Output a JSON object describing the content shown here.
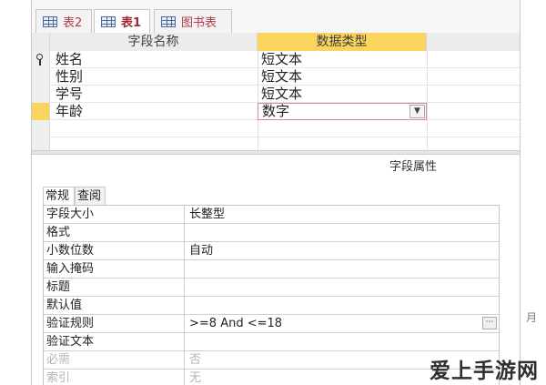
{
  "tabs": [
    {
      "label": "表2"
    },
    {
      "label": "表1"
    },
    {
      "label": "图书表"
    }
  ],
  "grid": {
    "headers": {
      "field_name": "字段名称",
      "data_type": "数据类型"
    },
    "rows": [
      {
        "name": "姓名",
        "type": "短文本"
      },
      {
        "name": "性别",
        "type": "短文本"
      },
      {
        "name": "学号",
        "type": "短文本"
      },
      {
        "name": "年龄",
        "type": "数字"
      }
    ]
  },
  "properties": {
    "section_label": "字段属性",
    "tabs": [
      {
        "label": "常规"
      },
      {
        "label": "查阅"
      }
    ],
    "rows": [
      {
        "label": "字段大小",
        "value": "长整型"
      },
      {
        "label": "格式",
        "value": ""
      },
      {
        "label": "小数位数",
        "value": "自动"
      },
      {
        "label": "输入掩码",
        "value": ""
      },
      {
        "label": "标题",
        "value": ""
      },
      {
        "label": "默认值",
        "value": ""
      },
      {
        "label": "验证规则",
        "value": ">=8 And <=18"
      },
      {
        "label": "验证文本",
        "value": ""
      },
      {
        "label": "必需",
        "value": "否"
      },
      {
        "label": "索引",
        "value": "无"
      }
    ],
    "side_glyph": "月"
  },
  "watermark": "爱上手游网",
  "icons": {
    "tab": "table-icon",
    "key": "primary-key-icon",
    "dropdown": "chevron-down-icon",
    "builder": "ellipsis-icon"
  },
  "colors": {
    "header_highlight": "#fbd45d",
    "tab_text": "#b23a47"
  }
}
